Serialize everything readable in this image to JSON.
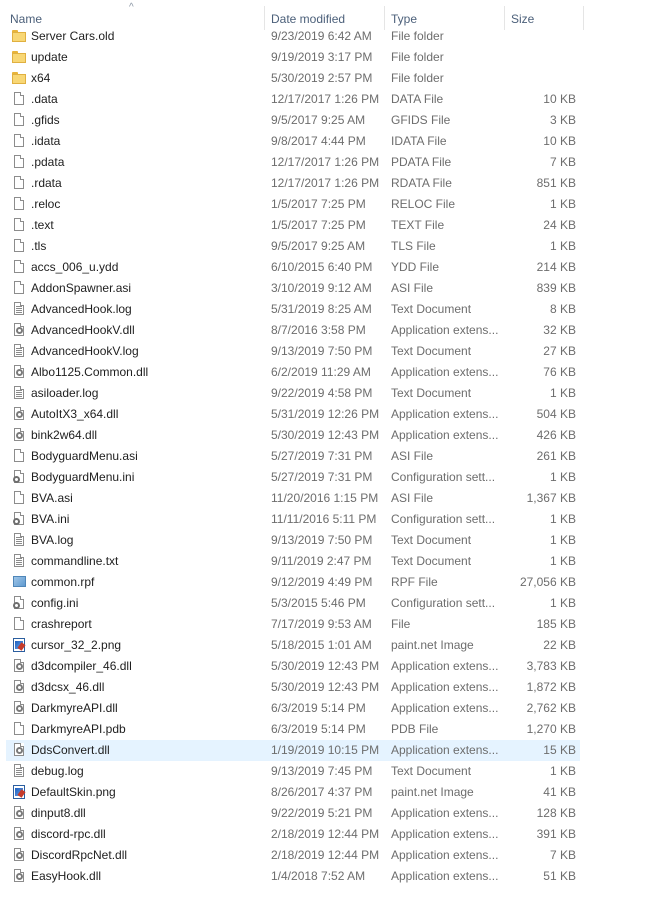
{
  "columns": {
    "name": "Name",
    "date": "Date modified",
    "type": "Type",
    "size": "Size"
  },
  "files": [
    {
      "name": "Server Cars.old",
      "date": "9/23/2019 6:42 AM",
      "type": "File folder",
      "size": "",
      "icon": "folder-icon"
    },
    {
      "name": "update",
      "date": "9/19/2019 3:17 PM",
      "type": "File folder",
      "size": "",
      "icon": "folder-icon"
    },
    {
      "name": "x64",
      "date": "5/30/2019 2:57 PM",
      "type": "File folder",
      "size": "",
      "icon": "folder-icon"
    },
    {
      "name": ".data",
      "date": "12/17/2017 1:26 PM",
      "type": "DATA File",
      "size": "10 KB",
      "icon": "file-icon"
    },
    {
      "name": ".gfids",
      "date": "9/5/2017 9:25 AM",
      "type": "GFIDS File",
      "size": "3 KB",
      "icon": "file-icon"
    },
    {
      "name": ".idata",
      "date": "9/8/2017 4:44 PM",
      "type": "IDATA File",
      "size": "10 KB",
      "icon": "file-icon"
    },
    {
      "name": ".pdata",
      "date": "12/17/2017 1:26 PM",
      "type": "PDATA File",
      "size": "7 KB",
      "icon": "file-icon"
    },
    {
      "name": ".rdata",
      "date": "12/17/2017 1:26 PM",
      "type": "RDATA File",
      "size": "851 KB",
      "icon": "file-icon"
    },
    {
      "name": ".reloc",
      "date": "1/5/2017 7:25 PM",
      "type": "RELOC File",
      "size": "1 KB",
      "icon": "file-icon"
    },
    {
      "name": ".text",
      "date": "1/5/2017 7:25 PM",
      "type": "TEXT File",
      "size": "24 KB",
      "icon": "file-icon"
    },
    {
      "name": ".tls",
      "date": "9/5/2017 9:25 AM",
      "type": "TLS File",
      "size": "1 KB",
      "icon": "file-icon"
    },
    {
      "name": "accs_006_u.ydd",
      "date": "6/10/2015 6:40 PM",
      "type": "YDD File",
      "size": "214 KB",
      "icon": "file-icon"
    },
    {
      "name": "AddonSpawner.asi",
      "date": "3/10/2019 9:12 AM",
      "type": "ASI File",
      "size": "839 KB",
      "icon": "file-icon"
    },
    {
      "name": "AdvancedHook.log",
      "date": "5/31/2019 8:25 AM",
      "type": "Text Document",
      "size": "8 KB",
      "icon": "text-document-icon"
    },
    {
      "name": "AdvancedHookV.dll",
      "date": "8/7/2016 3:58 PM",
      "type": "Application extens...",
      "size": "32 KB",
      "icon": "dll-icon"
    },
    {
      "name": "AdvancedHookV.log",
      "date": "9/13/2019 7:50 PM",
      "type": "Text Document",
      "size": "27 KB",
      "icon": "text-document-icon"
    },
    {
      "name": "Albo1125.Common.dll",
      "date": "6/2/2019 11:29 AM",
      "type": "Application extens...",
      "size": "76 KB",
      "icon": "dll-icon"
    },
    {
      "name": "asiloader.log",
      "date": "9/22/2019 4:58 PM",
      "type": "Text Document",
      "size": "1 KB",
      "icon": "text-document-icon"
    },
    {
      "name": "AutoItX3_x64.dll",
      "date": "5/31/2019 12:26 PM",
      "type": "Application extens...",
      "size": "504 KB",
      "icon": "dll-icon"
    },
    {
      "name": "bink2w64.dll",
      "date": "5/30/2019 12:43 PM",
      "type": "Application extens...",
      "size": "426 KB",
      "icon": "dll-icon"
    },
    {
      "name": "BodyguardMenu.asi",
      "date": "5/27/2019 7:31 PM",
      "type": "ASI File",
      "size": "261 KB",
      "icon": "file-icon"
    },
    {
      "name": "BodyguardMenu.ini",
      "date": "5/27/2019 7:31 PM",
      "type": "Configuration sett...",
      "size": "1 KB",
      "icon": "config-icon"
    },
    {
      "name": "BVA.asi",
      "date": "11/20/2016 1:15 PM",
      "type": "ASI File",
      "size": "1,367 KB",
      "icon": "file-icon"
    },
    {
      "name": "BVA.ini",
      "date": "11/11/2016 5:11 PM",
      "type": "Configuration sett...",
      "size": "1 KB",
      "icon": "config-icon"
    },
    {
      "name": "BVA.log",
      "date": "9/13/2019 7:50 PM",
      "type": "Text Document",
      "size": "1 KB",
      "icon": "text-document-icon"
    },
    {
      "name": "commandline.txt",
      "date": "9/11/2019 2:47 PM",
      "type": "Text Document",
      "size": "1 KB",
      "icon": "text-document-icon"
    },
    {
      "name": "common.rpf",
      "date": "9/12/2019 4:49 PM",
      "type": "RPF File",
      "size": "27,056 KB",
      "icon": "rpf-icon"
    },
    {
      "name": "config.ini",
      "date": "5/3/2015 5:46 PM",
      "type": "Configuration sett...",
      "size": "1 KB",
      "icon": "config-icon"
    },
    {
      "name": "crashreport",
      "date": "7/17/2019 9:53 AM",
      "type": "File",
      "size": "185 KB",
      "icon": "file-icon"
    },
    {
      "name": "cursor_32_2.png",
      "date": "5/18/2015 1:01 AM",
      "type": "paint.net Image",
      "size": "22 KB",
      "icon": "image-icon"
    },
    {
      "name": "d3dcompiler_46.dll",
      "date": "5/30/2019 12:43 PM",
      "type": "Application extens...",
      "size": "3,783 KB",
      "icon": "dll-icon"
    },
    {
      "name": "d3dcsx_46.dll",
      "date": "5/30/2019 12:43 PM",
      "type": "Application extens...",
      "size": "1,872 KB",
      "icon": "dll-icon"
    },
    {
      "name": "DarkmyreAPI.dll",
      "date": "6/3/2019 5:14 PM",
      "type": "Application extens...",
      "size": "2,762 KB",
      "icon": "dll-icon"
    },
    {
      "name": "DarkmyreAPI.pdb",
      "date": "6/3/2019 5:14 PM",
      "type": "PDB File",
      "size": "1,270 KB",
      "icon": "file-icon"
    },
    {
      "name": "DdsConvert.dll",
      "date": "1/19/2019 10:15 PM",
      "type": "Application extens...",
      "size": "15 KB",
      "icon": "dll-icon",
      "selected": true
    },
    {
      "name": "debug.log",
      "date": "9/13/2019 7:45 PM",
      "type": "Text Document",
      "size": "1 KB",
      "icon": "text-document-icon"
    },
    {
      "name": "DefaultSkin.png",
      "date": "8/26/2017 4:37 PM",
      "type": "paint.net Image",
      "size": "41 KB",
      "icon": "image-icon"
    },
    {
      "name": "dinput8.dll",
      "date": "9/22/2019 5:21 PM",
      "type": "Application extens...",
      "size": "128 KB",
      "icon": "dll-icon"
    },
    {
      "name": "discord-rpc.dll",
      "date": "2/18/2019 12:44 PM",
      "type": "Application extens...",
      "size": "391 KB",
      "icon": "dll-icon"
    },
    {
      "name": "DiscordRpcNet.dll",
      "date": "2/18/2019 12:44 PM",
      "type": "Application extens...",
      "size": "7 KB",
      "icon": "dll-icon"
    },
    {
      "name": "EasyHook.dll",
      "date": "1/4/2018 7:52 AM",
      "type": "Application extens...",
      "size": "51 KB",
      "icon": "dll-icon"
    }
  ]
}
